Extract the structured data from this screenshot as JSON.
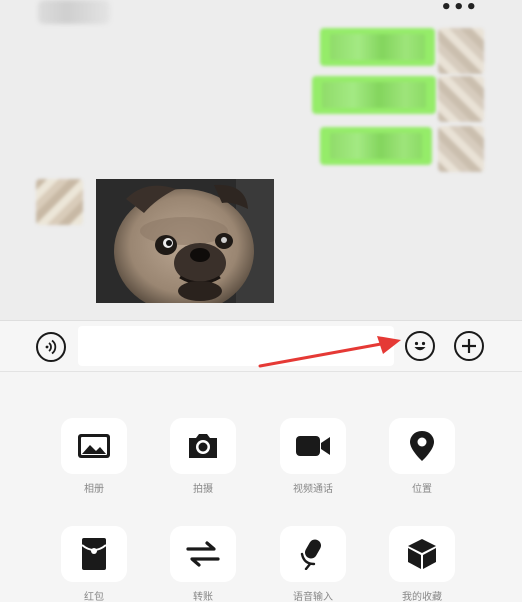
{
  "header": {
    "more_label": "•••"
  },
  "messages": {
    "outgoing": [
      {
        "content": "",
        "sender": "self"
      },
      {
        "content": "",
        "sender": "self"
      },
      {
        "content": "",
        "sender": "self"
      }
    ],
    "incoming": [
      {
        "type": "image",
        "content_icon": "pug-photo",
        "sender": "other"
      }
    ]
  },
  "input_bar": {
    "voice_icon": "voice-icon",
    "text_value": "",
    "emoji_icon": "emoji-icon",
    "plus_icon": "plus-icon"
  },
  "annotation": {
    "arrow_color": "#e53935"
  },
  "more_panel": {
    "items": [
      {
        "icon": "album-icon",
        "label": "相册"
      },
      {
        "icon": "camera-icon",
        "label": "拍摄"
      },
      {
        "icon": "video-call-icon",
        "label": "视频通话"
      },
      {
        "icon": "location-icon",
        "label": "位置"
      },
      {
        "icon": "red-packet-icon",
        "label": "红包"
      },
      {
        "icon": "transfer-icon",
        "label": "转账"
      },
      {
        "icon": "voice-input-icon",
        "label": "语音输入"
      },
      {
        "icon": "favorites-icon",
        "label": "我的收藏"
      }
    ]
  },
  "colors": {
    "bubble_out": "#95ec69",
    "background": "#ededed",
    "panel": "#f5f5f5",
    "icon": "#1a1a1a"
  }
}
